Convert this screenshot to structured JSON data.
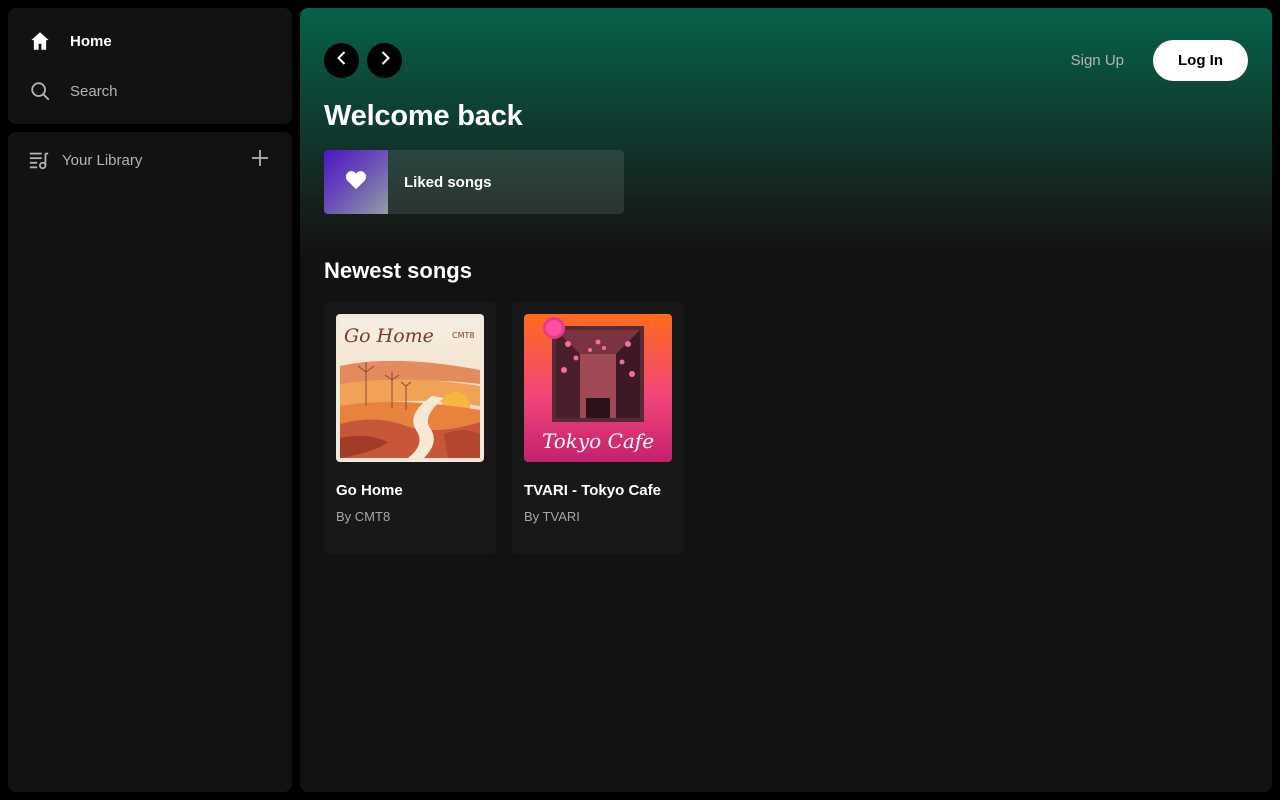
{
  "sidebar": {
    "nav": [
      {
        "label": "Home",
        "icon": "home-icon"
      },
      {
        "label": "Search",
        "icon": "search-icon"
      }
    ],
    "library": {
      "label": "Your Library",
      "icon": "library-icon",
      "add_icon": "plus-icon"
    }
  },
  "header": {
    "back_icon": "chevron-left-icon",
    "forward_icon": "chevron-right-icon",
    "signup_label": "Sign Up",
    "login_label": "Log In"
  },
  "main": {
    "welcome": "Welcome back",
    "liked": {
      "label": "Liked songs",
      "icon": "heart-icon"
    },
    "newest_title": "Newest songs",
    "songs": [
      {
        "title": "Go Home",
        "artist": "By CMT8",
        "cover_text": "Go Home",
        "cover_sub": "CMT8"
      },
      {
        "title": "TVARI - Tokyo Cafe",
        "artist": "By TVARI",
        "cover_text": "Tokyo Cafe"
      }
    ]
  },
  "colors": {
    "accent_green": "#06624a",
    "background": "#121212",
    "card": "#181818",
    "muted_text": "#b3b3b3"
  }
}
